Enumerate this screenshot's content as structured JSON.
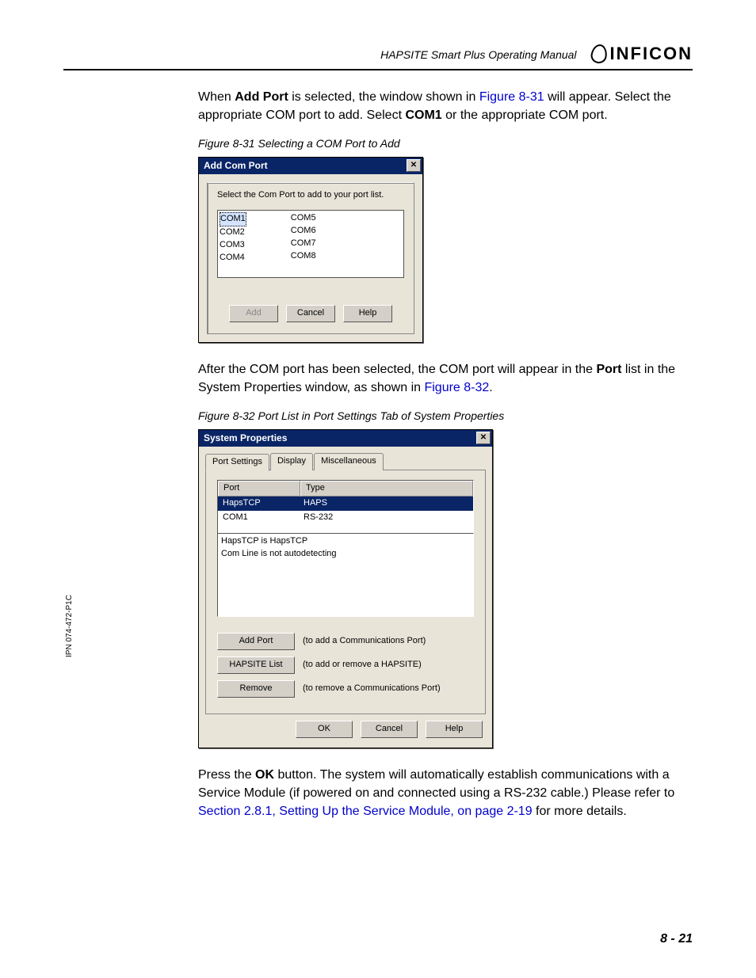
{
  "header": {
    "manual_title": "HAPSITE Smart Plus Operating Manual",
    "brand": "INFICON"
  },
  "para1": {
    "t1": "When ",
    "b1": "Add Port",
    "t2": " is selected, the window shown in ",
    "link1": "Figure 8-31",
    "t3": " will appear. Select the appropriate COM port to add. Select ",
    "b2": "COM1",
    "t4": " or the appropriate COM port."
  },
  "fig31": {
    "caption": "Figure 8-31  Selecting a COM Port to Add",
    "title": "Add Com Port",
    "instruction": "Select the Com Port to add to your port list.",
    "col1": [
      "COM1",
      "COM2",
      "COM3",
      "COM4"
    ],
    "col2": [
      "COM5",
      "COM6",
      "COM7",
      "COM8"
    ],
    "buttons": {
      "add": "Add",
      "cancel": "Cancel",
      "help": "Help"
    }
  },
  "para2": {
    "t1": "After the COM port has been selected, the COM port will appear in the ",
    "b1": "Port",
    "t2": " list in the System Properties window, as shown in ",
    "link1": "Figure 8-32",
    "t3": "."
  },
  "fig32": {
    "caption": "Figure 8-32  Port List in Port Settings Tab of System Properties",
    "title": "System Properties",
    "tabs": {
      "t1": "Port Settings",
      "t2": "Display",
      "t3": "Miscellaneous"
    },
    "list": {
      "hdr_port": "Port",
      "hdr_type": "Type",
      "rows": [
        {
          "port": "HapsTCP",
          "type": "HAPS"
        },
        {
          "port": "COM1",
          "type": "RS-232"
        }
      ]
    },
    "status": {
      "l1": "HapsTCP is HapsTCP",
      "l2": "Com Line is not autodetecting"
    },
    "btncol": {
      "addport": "Add Port",
      "addport_desc": "(to add a Communications Port)",
      "hapsite": "HAPSITE List",
      "hapsite_desc": "(to add or remove a HAPSITE)",
      "remove": "Remove",
      "remove_desc": "(to remove a Communications Port)"
    },
    "bottom": {
      "ok": "OK",
      "cancel": "Cancel",
      "help": "Help"
    }
  },
  "para3": {
    "t1": "Press the ",
    "b1": "OK",
    "t2": " button. The system will automatically establish communications with a Service Module (if powered on and connected using a RS-232 cable.) Please refer to ",
    "link1": "Section 2.8.1, Setting Up the Service Module, on page 2-19",
    "t3": " for more details."
  },
  "side": "IPN 074-472-P1C",
  "page_number": "8 - 21"
}
